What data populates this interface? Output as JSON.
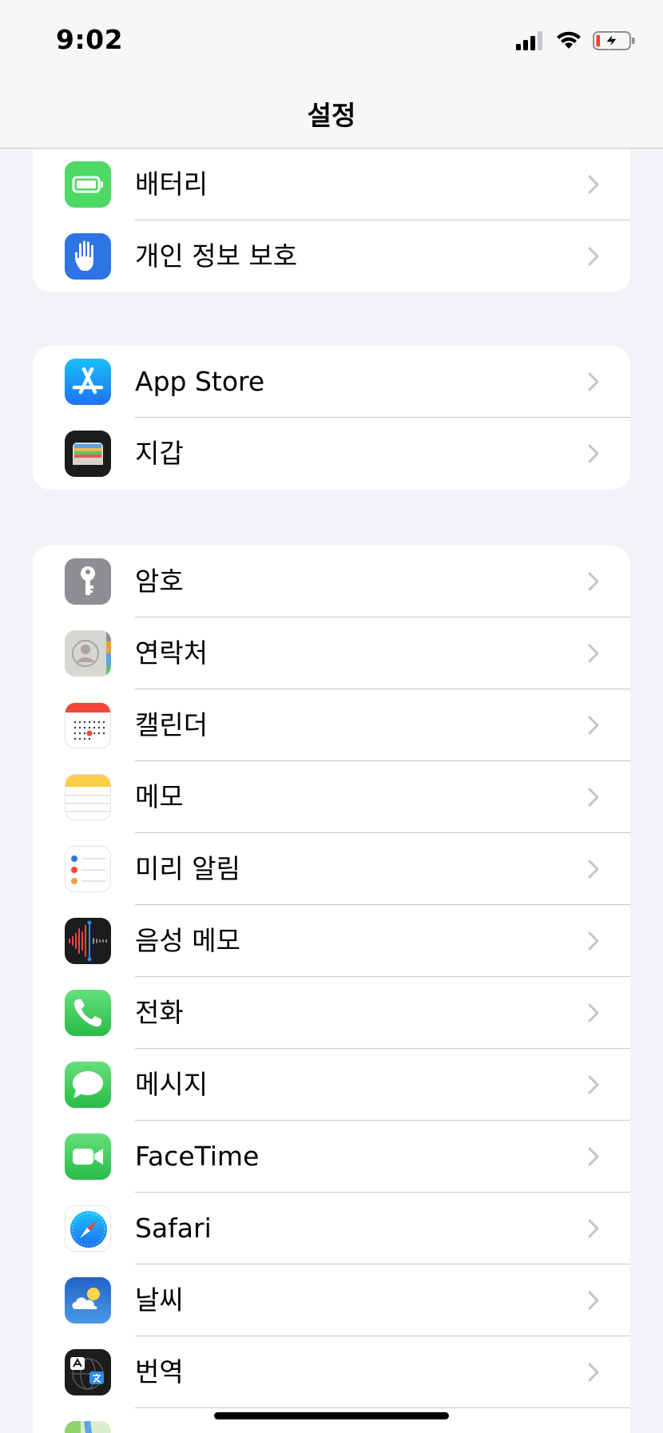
{
  "status": {
    "time": "9:02"
  },
  "nav": {
    "title": "설정"
  },
  "groups": [
    [
      {
        "label": "배터리",
        "icon": "battery-icon"
      },
      {
        "label": "개인 정보 보호",
        "icon": "hand-icon"
      }
    ],
    [
      {
        "label": "App Store",
        "icon": "app-store-icon"
      },
      {
        "label": "지갑",
        "icon": "wallet-icon"
      }
    ],
    [
      {
        "label": "암호",
        "icon": "key-icon"
      },
      {
        "label": "연락처",
        "icon": "contacts-icon"
      },
      {
        "label": "캘린더",
        "icon": "calendar-icon"
      },
      {
        "label": "메모",
        "icon": "notes-icon"
      },
      {
        "label": "미리 알림",
        "icon": "reminders-icon"
      },
      {
        "label": "음성 메모",
        "icon": "voice-memo-icon"
      },
      {
        "label": "전화",
        "icon": "phone-icon"
      },
      {
        "label": "메시지",
        "icon": "messages-icon"
      },
      {
        "label": "FaceTime",
        "icon": "facetime-icon"
      },
      {
        "label": "Safari",
        "icon": "safari-icon"
      },
      {
        "label": "날씨",
        "icon": "weather-icon"
      },
      {
        "label": "번역",
        "icon": "translate-icon"
      },
      {
        "label": "",
        "icon": "maps-icon"
      }
    ]
  ],
  "colors": {
    "accent_arrow": "#d9603f",
    "background": "#f2f2f7",
    "separator": "#c8c7cc"
  }
}
